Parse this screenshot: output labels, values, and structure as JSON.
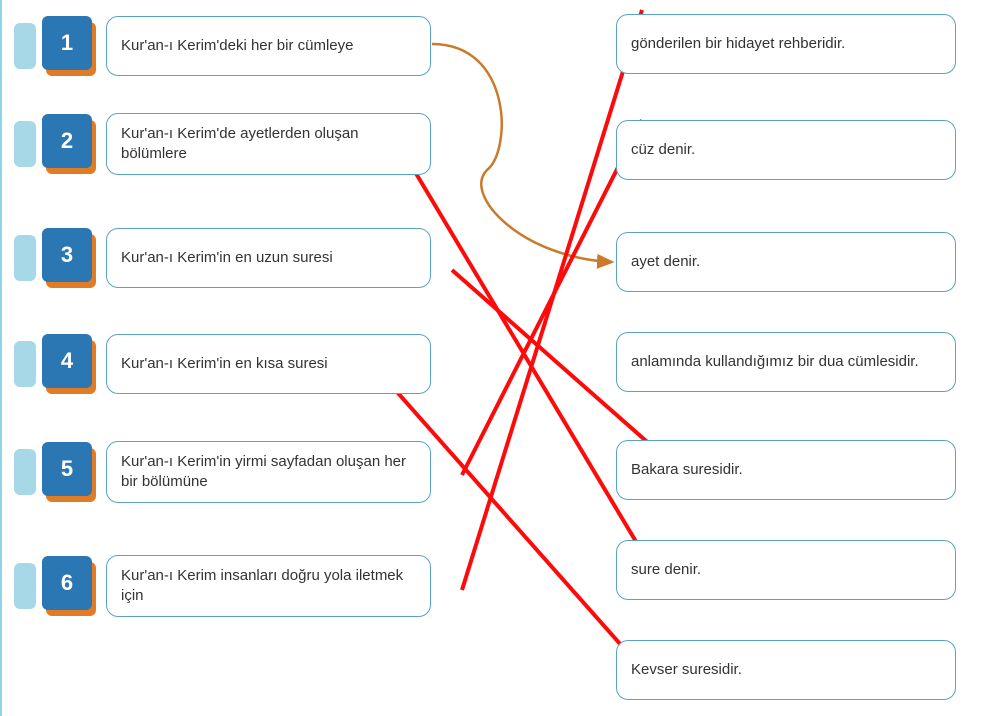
{
  "colors": {
    "border": "#5aa3c7",
    "badge_bg": "#2a77b4",
    "badge_shadow": "#e07b26",
    "handle": "#a6d8e8",
    "curve": "#c97a2b",
    "match_line": "#ff0a0a"
  },
  "left_items": [
    {
      "num": "1",
      "text": "Kur'an-ı Kerim'deki her bir cümleye"
    },
    {
      "num": "2",
      "text": "Kur'an-ı Kerim'de ayetlerden oluşan bölümlere"
    },
    {
      "num": "3",
      "text": "Kur'an-ı Kerim'in en uzun suresi"
    },
    {
      "num": "4",
      "text": "Kur'an-ı Kerim'in en kısa suresi"
    },
    {
      "num": "5",
      "text": "Kur'an-ı Kerim'in yirmi sayfadan oluşan her bir bölümüne"
    },
    {
      "num": "6",
      "text": "Kur'an-ı Kerim insanları doğru yola iletmek için"
    }
  ],
  "right_items": [
    {
      "text": "gönderilen bir hidayet rehberidir."
    },
    {
      "text": "cüz denir."
    },
    {
      "text": "ayet denir."
    },
    {
      "text": "anlamında kullandığımız bir dua cümlesidir."
    },
    {
      "text": "Bakara suresidir."
    },
    {
      "text": "sure denir."
    },
    {
      "text": "Kevser suresidir."
    }
  ],
  "curved_example_connection": {
    "from_left_index": 0,
    "to_right_index": 2
  },
  "annotations": [
    {
      "from_left_index": 1,
      "to_right_index": 5
    },
    {
      "from_left_index": 2,
      "to_right_index": 4
    },
    {
      "from_left_index": 3,
      "to_right_index": 6
    },
    {
      "from_left_index": 4,
      "to_right_index": 1
    },
    {
      "from_left_index": 5,
      "to_right_index": 0
    }
  ]
}
